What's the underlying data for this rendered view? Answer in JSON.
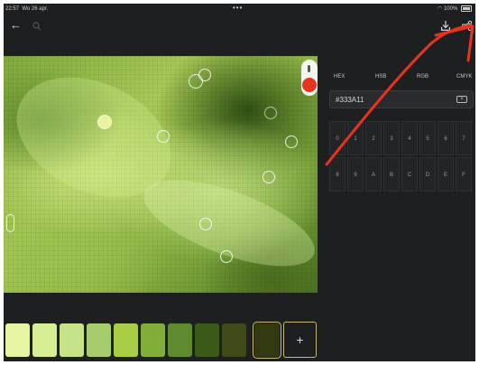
{
  "status_bar": {
    "time": "22:57",
    "date": "Wo 26 apr.",
    "center_dots": "•••",
    "battery": "100%"
  },
  "nav": {
    "back_icon": "arrow-left-icon",
    "search_icon": "search-icon",
    "download_icon": "download-icon",
    "share_icon": "share-icon"
  },
  "color_modes": [
    "HEX",
    "HSB",
    "RGB",
    "CMYK"
  ],
  "hex_input": {
    "value": "#333A11",
    "clear_icon": "backspace-icon"
  },
  "keypad": {
    "row1": [
      "0",
      "1",
      "2",
      "3",
      "4",
      "5",
      "6",
      "7"
    ],
    "row2": [
      "8",
      "9",
      "A",
      "B",
      "C",
      "D",
      "E",
      "F"
    ]
  },
  "picker": {
    "indicator_color": "#e8331f"
  },
  "swatches": [
    {
      "color": "#e6f3a1"
    },
    {
      "color": "#d8ee95"
    },
    {
      "color": "#c6e387"
    },
    {
      "color": "#a6cc6e"
    },
    {
      "color": "#a9cd45"
    },
    {
      "color": "#80ae38"
    },
    {
      "color": "#5f8b2e"
    },
    {
      "color": "#3b5a17"
    },
    {
      "color": "#3e4a18"
    },
    {
      "color": "#333a11"
    }
  ],
  "add_button_label": "+",
  "annotation_color": "#e8331f"
}
